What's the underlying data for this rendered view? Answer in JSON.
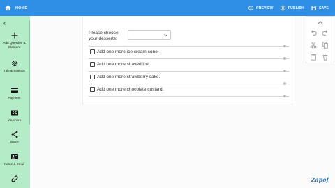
{
  "topbar": {
    "home_label": "HOME",
    "preview_label": "PREVIEW",
    "publish_label": "PUBLISH",
    "save_label": "SAVE",
    "bar_color": "#2f8fe6"
  },
  "sidebar": {
    "back_icon": "chevron-left-icon",
    "items": [
      {
        "label": "Add Question & Element",
        "icon": "plus-icon"
      },
      {
        "label": "Title & Settings",
        "icon": "gear-icon"
      },
      {
        "label": "Payment",
        "icon": "credit-card-icon"
      },
      {
        "label": "Vouchers",
        "icon": "voucher-icon"
      },
      {
        "label": "Share",
        "icon": "share-icon"
      },
      {
        "label": "Name & Email",
        "icon": "contact-card-icon"
      },
      {
        "label": "",
        "icon": "link-icon"
      }
    ],
    "bg_color": "#b4ecc7"
  },
  "form": {
    "question_label": "Please choose your desserts:",
    "select_value": "",
    "options": [
      "Add one more ice cream cone.",
      "Add one more shaved ice.",
      "Add one more strawberry cake.",
      "Add one more chocolate custard."
    ]
  },
  "tools": {
    "icons": [
      "chevron-up-icon",
      "undo-icon",
      "redo-icon",
      "cut-icon",
      "copy-icon",
      "paste-icon",
      "delete-icon"
    ]
  },
  "brand": {
    "logo_text": "Zapof"
  }
}
